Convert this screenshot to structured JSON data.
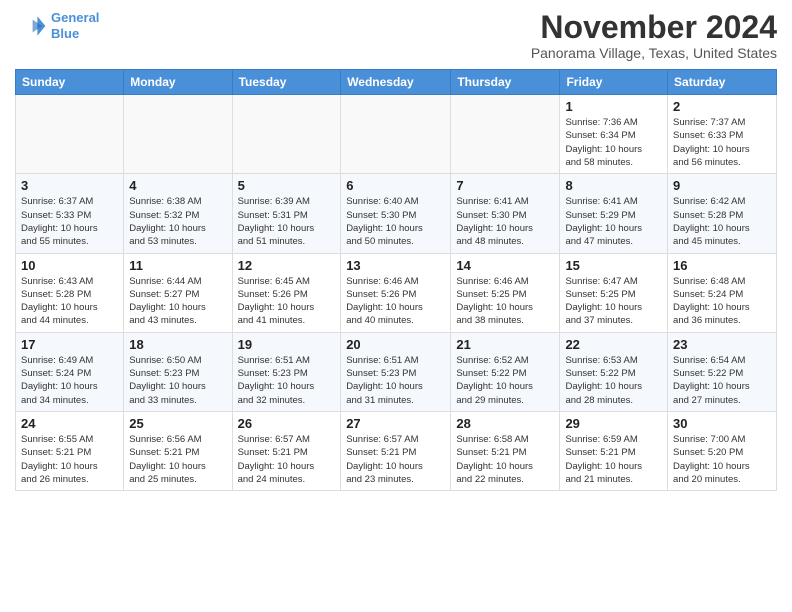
{
  "header": {
    "logo_line1": "General",
    "logo_line2": "Blue",
    "month_title": "November 2024",
    "subtitle": "Panorama Village, Texas, United States"
  },
  "weekdays": [
    "Sunday",
    "Monday",
    "Tuesday",
    "Wednesday",
    "Thursday",
    "Friday",
    "Saturday"
  ],
  "weeks": [
    [
      {
        "day": "",
        "info": ""
      },
      {
        "day": "",
        "info": ""
      },
      {
        "day": "",
        "info": ""
      },
      {
        "day": "",
        "info": ""
      },
      {
        "day": "",
        "info": ""
      },
      {
        "day": "1",
        "info": "Sunrise: 7:36 AM\nSunset: 6:34 PM\nDaylight: 10 hours\nand 58 minutes."
      },
      {
        "day": "2",
        "info": "Sunrise: 7:37 AM\nSunset: 6:33 PM\nDaylight: 10 hours\nand 56 minutes."
      }
    ],
    [
      {
        "day": "3",
        "info": "Sunrise: 6:37 AM\nSunset: 5:33 PM\nDaylight: 10 hours\nand 55 minutes."
      },
      {
        "day": "4",
        "info": "Sunrise: 6:38 AM\nSunset: 5:32 PM\nDaylight: 10 hours\nand 53 minutes."
      },
      {
        "day": "5",
        "info": "Sunrise: 6:39 AM\nSunset: 5:31 PM\nDaylight: 10 hours\nand 51 minutes."
      },
      {
        "day": "6",
        "info": "Sunrise: 6:40 AM\nSunset: 5:30 PM\nDaylight: 10 hours\nand 50 minutes."
      },
      {
        "day": "7",
        "info": "Sunrise: 6:41 AM\nSunset: 5:30 PM\nDaylight: 10 hours\nand 48 minutes."
      },
      {
        "day": "8",
        "info": "Sunrise: 6:41 AM\nSunset: 5:29 PM\nDaylight: 10 hours\nand 47 minutes."
      },
      {
        "day": "9",
        "info": "Sunrise: 6:42 AM\nSunset: 5:28 PM\nDaylight: 10 hours\nand 45 minutes."
      }
    ],
    [
      {
        "day": "10",
        "info": "Sunrise: 6:43 AM\nSunset: 5:28 PM\nDaylight: 10 hours\nand 44 minutes."
      },
      {
        "day": "11",
        "info": "Sunrise: 6:44 AM\nSunset: 5:27 PM\nDaylight: 10 hours\nand 43 minutes."
      },
      {
        "day": "12",
        "info": "Sunrise: 6:45 AM\nSunset: 5:26 PM\nDaylight: 10 hours\nand 41 minutes."
      },
      {
        "day": "13",
        "info": "Sunrise: 6:46 AM\nSunset: 5:26 PM\nDaylight: 10 hours\nand 40 minutes."
      },
      {
        "day": "14",
        "info": "Sunrise: 6:46 AM\nSunset: 5:25 PM\nDaylight: 10 hours\nand 38 minutes."
      },
      {
        "day": "15",
        "info": "Sunrise: 6:47 AM\nSunset: 5:25 PM\nDaylight: 10 hours\nand 37 minutes."
      },
      {
        "day": "16",
        "info": "Sunrise: 6:48 AM\nSunset: 5:24 PM\nDaylight: 10 hours\nand 36 minutes."
      }
    ],
    [
      {
        "day": "17",
        "info": "Sunrise: 6:49 AM\nSunset: 5:24 PM\nDaylight: 10 hours\nand 34 minutes."
      },
      {
        "day": "18",
        "info": "Sunrise: 6:50 AM\nSunset: 5:23 PM\nDaylight: 10 hours\nand 33 minutes."
      },
      {
        "day": "19",
        "info": "Sunrise: 6:51 AM\nSunset: 5:23 PM\nDaylight: 10 hours\nand 32 minutes."
      },
      {
        "day": "20",
        "info": "Sunrise: 6:51 AM\nSunset: 5:23 PM\nDaylight: 10 hours\nand 31 minutes."
      },
      {
        "day": "21",
        "info": "Sunrise: 6:52 AM\nSunset: 5:22 PM\nDaylight: 10 hours\nand 29 minutes."
      },
      {
        "day": "22",
        "info": "Sunrise: 6:53 AM\nSunset: 5:22 PM\nDaylight: 10 hours\nand 28 minutes."
      },
      {
        "day": "23",
        "info": "Sunrise: 6:54 AM\nSunset: 5:22 PM\nDaylight: 10 hours\nand 27 minutes."
      }
    ],
    [
      {
        "day": "24",
        "info": "Sunrise: 6:55 AM\nSunset: 5:21 PM\nDaylight: 10 hours\nand 26 minutes."
      },
      {
        "day": "25",
        "info": "Sunrise: 6:56 AM\nSunset: 5:21 PM\nDaylight: 10 hours\nand 25 minutes."
      },
      {
        "day": "26",
        "info": "Sunrise: 6:57 AM\nSunset: 5:21 PM\nDaylight: 10 hours\nand 24 minutes."
      },
      {
        "day": "27",
        "info": "Sunrise: 6:57 AM\nSunset: 5:21 PM\nDaylight: 10 hours\nand 23 minutes."
      },
      {
        "day": "28",
        "info": "Sunrise: 6:58 AM\nSunset: 5:21 PM\nDaylight: 10 hours\nand 22 minutes."
      },
      {
        "day": "29",
        "info": "Sunrise: 6:59 AM\nSunset: 5:21 PM\nDaylight: 10 hours\nand 21 minutes."
      },
      {
        "day": "30",
        "info": "Sunrise: 7:00 AM\nSunset: 5:20 PM\nDaylight: 10 hours\nand 20 minutes."
      }
    ]
  ]
}
